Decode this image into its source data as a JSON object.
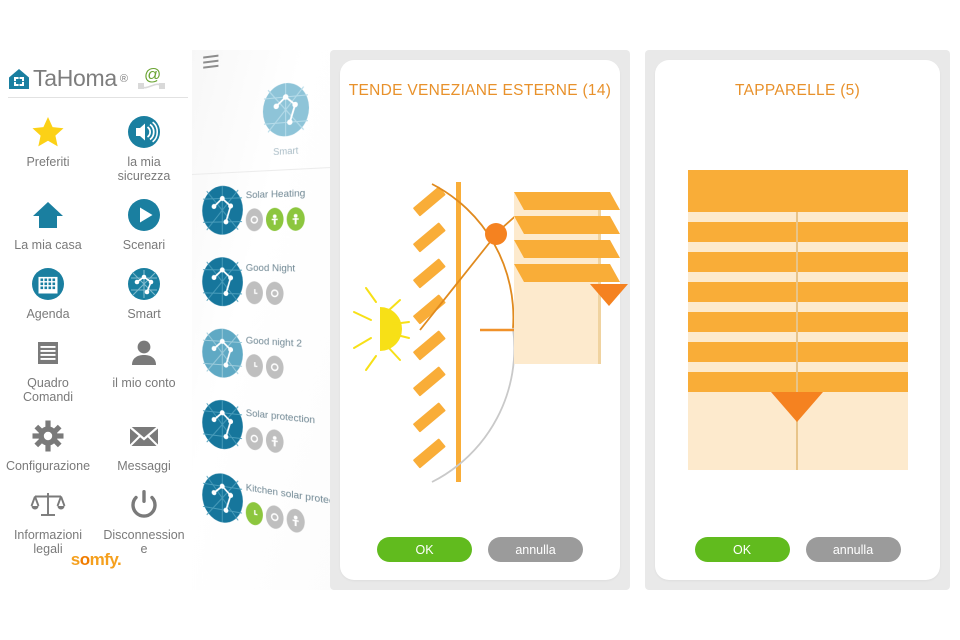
{
  "app": {
    "brand_name": "TaHoma",
    "brand_registered": "®",
    "brand_icon": "house-icon",
    "connect_icon": "at-network-icon",
    "footer_logo_pre": "s",
    "footer_logo_o": "o",
    "footer_logo_post": "mfy."
  },
  "colors": {
    "teal": "#1a7fa0",
    "orange": "#f5a623",
    "orange_dark": "#f07c00",
    "title_orange": "#e8912b",
    "green": "#61bb1e",
    "badge_green": "#8cc63e",
    "gray": "#9b9b9b",
    "beige": "#fdeacd",
    "yellow": "#f7e017"
  },
  "sidebar": {
    "items": [
      {
        "label": "Preferiti",
        "icon": "star-icon"
      },
      {
        "label": "la mia sicurezza",
        "icon": "speaker-alarm-icon"
      },
      {
        "label": "La mia casa",
        "icon": "house-icon"
      },
      {
        "label": "Scenari",
        "icon": "play-icon"
      },
      {
        "label": "Agenda",
        "icon": "calendar-icon"
      },
      {
        "label": "Smart",
        "icon": "smart-network-icon"
      },
      {
        "label": "Quadro Comandi",
        "icon": "control-panel-icon"
      },
      {
        "label": "il mio conto",
        "icon": "user-account-icon"
      },
      {
        "label": "Configurazione",
        "icon": "gear-icon"
      },
      {
        "label": "Messaggi",
        "icon": "envelope-icon"
      },
      {
        "label": "Informazioni legali",
        "icon": "scales-icon"
      },
      {
        "label": "Disconnessione",
        "icon": "power-icon"
      }
    ]
  },
  "scenario_panel": {
    "menu_icon": "hamburger-icon",
    "header": {
      "label": "Smart",
      "icon": "smart-network-icon"
    },
    "items": [
      {
        "name": "Solar Heating",
        "icon": "smart-network-icon",
        "badges": [
          "gray",
          "green",
          "green"
        ]
      },
      {
        "name": "Good Night",
        "icon": "smart-network-icon",
        "badges": [
          "gray",
          "gray"
        ]
      },
      {
        "name": "Good night 2",
        "icon": "smart-network-icon",
        "badges": [
          "gray",
          "gray"
        ]
      },
      {
        "name": "Solar protection",
        "icon": "smart-network-icon",
        "badges": [
          "gray",
          "gray"
        ]
      },
      {
        "name": "Kitchen solar protection",
        "icon": "smart-network-icon",
        "badges": [
          "green",
          "gray",
          "gray"
        ]
      }
    ]
  },
  "cards": [
    {
      "title": "TENDE VENEZIANE ESTERNE (14)",
      "illustration": "venetian-blind-sun-icon",
      "ok_label": "OK",
      "cancel_label": "annulla"
    },
    {
      "title": "TAPPARELLE (5)",
      "illustration": "roller-shutter-icon",
      "ok_label": "OK",
      "cancel_label": "annulla"
    }
  ]
}
